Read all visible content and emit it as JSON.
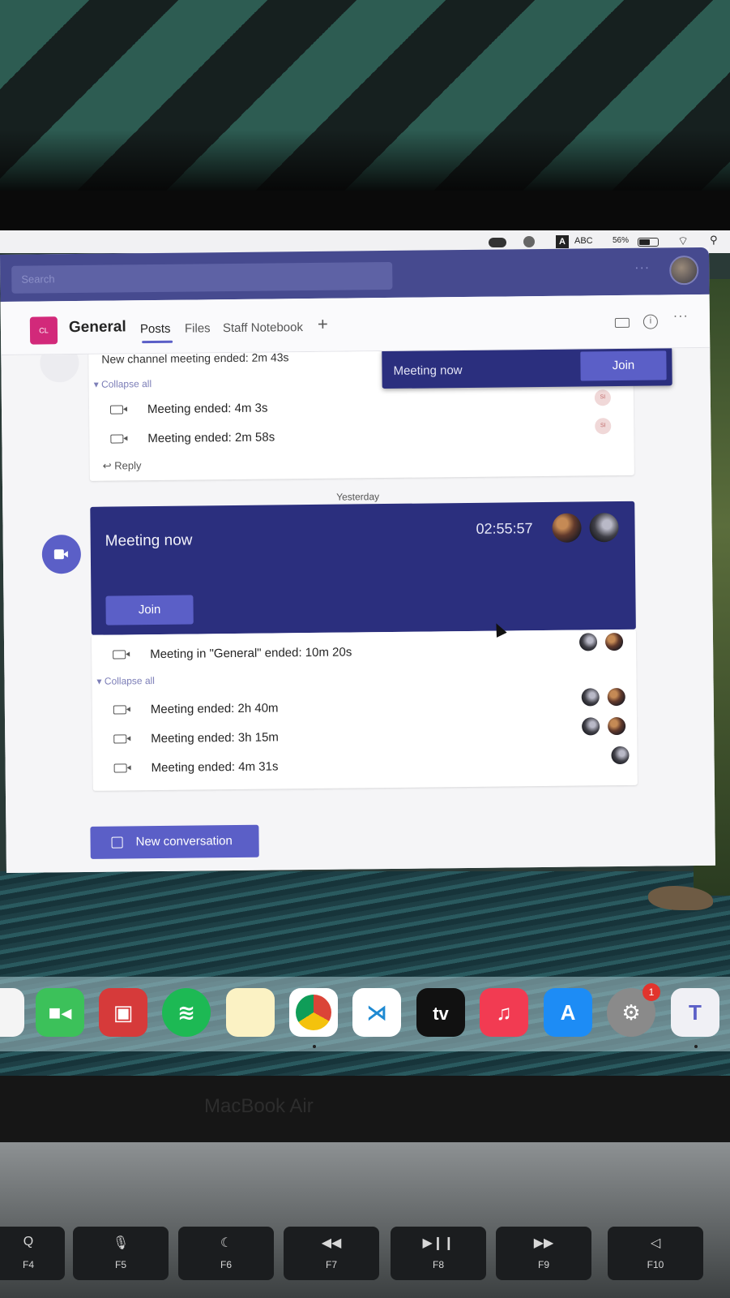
{
  "menubar": {
    "input_source": "A",
    "input_label": "ABC",
    "battery_percent": "56%"
  },
  "teams": {
    "search_placeholder": "Search",
    "team_initials": "CL",
    "channel_name": "General",
    "tabs": [
      {
        "label": "Posts",
        "active": true
      },
      {
        "label": "Files",
        "active": false
      },
      {
        "label": "Staff Notebook",
        "active": false
      }
    ],
    "add_tab_label": "+",
    "more_label": "···",
    "thread1": {
      "top_text": "New channel meeting ended: 2m 43s",
      "collapse_label": "Collapse all",
      "rows": [
        {
          "text": "Meeting ended: 4m 3s",
          "participant": "SI"
        },
        {
          "text": "Meeting ended: 2m 58s",
          "participant": "SI"
        }
      ],
      "reply_label": "Reply"
    },
    "toast": {
      "title": "Meeting now",
      "join_label": "Join"
    },
    "date_divider": "Yesterday",
    "live_meeting": {
      "title": "Meeting now",
      "timer": "02:55:57",
      "join_label": "Join"
    },
    "thread2": {
      "first_row": "Meeting in \"General\" ended: 10m 20s",
      "collapse_label": "Collapse all",
      "rows": [
        {
          "text": "Meeting ended: 2h 40m"
        },
        {
          "text": "Meeting ended: 3h 15m"
        },
        {
          "text": "Meeting ended: 4m 31s"
        }
      ]
    },
    "new_conversation_label": "New conversation"
  },
  "dock": {
    "apps": [
      "photos-icon",
      "facetime-icon",
      "photo-booth-icon",
      "spotify-icon",
      "notes-icon",
      "chrome-icon",
      "vscode-icon",
      "apple-tv-icon",
      "music-icon",
      "app-store-icon",
      "system-preferences-icon",
      "teams-icon"
    ],
    "tv_label": "tv",
    "settings_badge": "1"
  },
  "device_label": "MacBook Air",
  "keys": [
    {
      "glyph": "Q",
      "label": "F4"
    },
    {
      "glyph": "🎙",
      "label": "F5"
    },
    {
      "glyph": "☾",
      "label": "F6"
    },
    {
      "glyph": "◀◀",
      "label": "F7"
    },
    {
      "glyph": "▶❙❙",
      "label": "F8"
    },
    {
      "glyph": "▶▶",
      "label": "F9"
    },
    {
      "glyph": "◁",
      "label": "F10"
    }
  ],
  "colors": {
    "teams_purple": "#464a8f",
    "teams_accent": "#5b5fc7",
    "meeting_banner": "#2b2f7e"
  }
}
